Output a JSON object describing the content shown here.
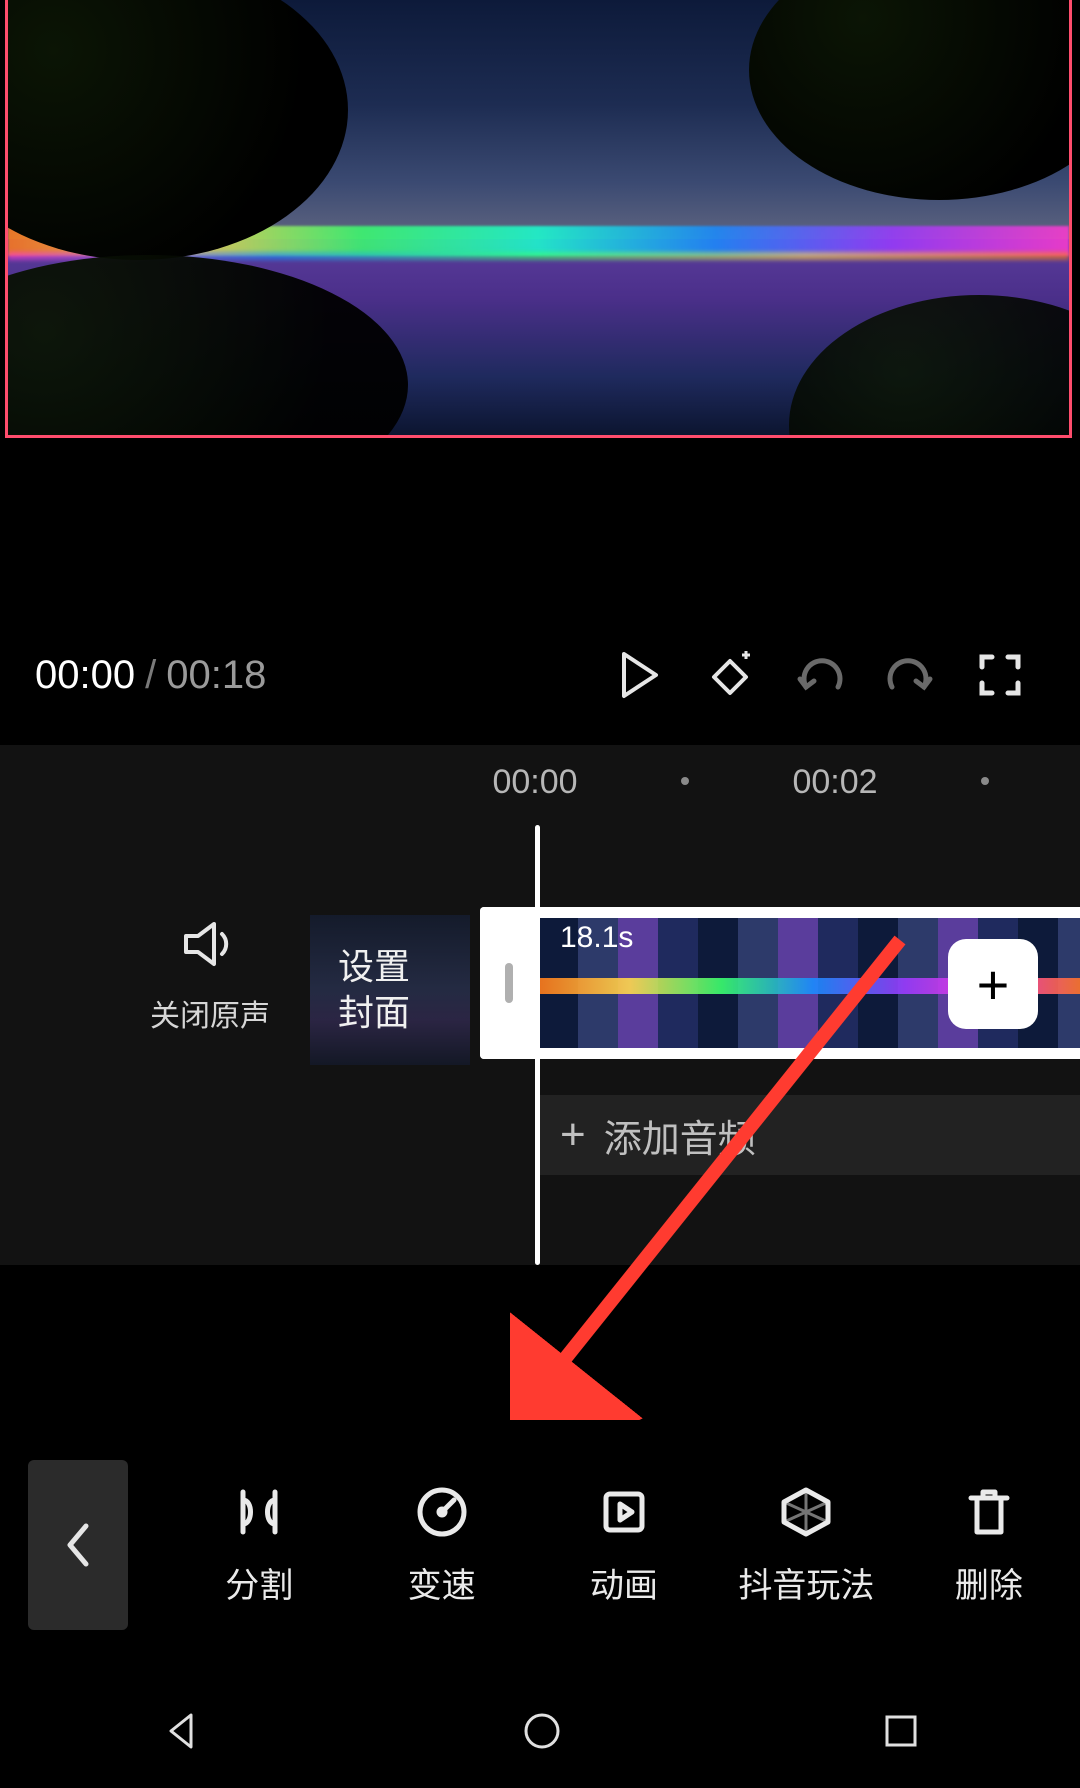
{
  "preview": {
    "current_time": "00:00",
    "separator": "/",
    "total_time": "00:18"
  },
  "timeline": {
    "ticks": [
      "00:00",
      "00:02"
    ],
    "clip_duration": "18.1s",
    "mute_original_label": "关闭原声",
    "set_cover_label": "设置\n封面",
    "add_audio_label": "添加音频",
    "add_clip_label": "+"
  },
  "toolbar": {
    "items": [
      {
        "label": "分割"
      },
      {
        "label": "变速"
      },
      {
        "label": "动画"
      },
      {
        "label": "抖音玩法"
      },
      {
        "label": "删除"
      }
    ]
  },
  "annotation": {
    "arrow_color": "#ff3b30"
  }
}
